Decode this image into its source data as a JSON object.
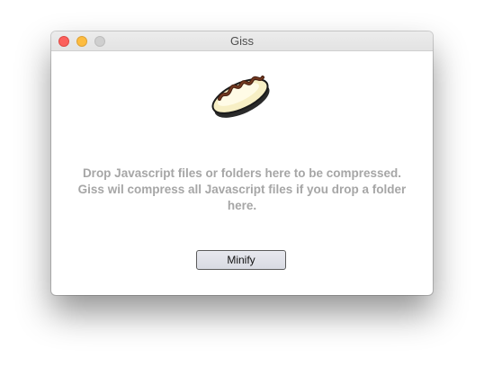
{
  "window": {
    "title": "Giss"
  },
  "titlebar": {
    "buttons": [
      "close",
      "minimize",
      "zoom"
    ]
  },
  "logo": {
    "icon": "eclair-pastry-icon"
  },
  "drop_area": {
    "lines": [
      "Drop Javascript files or folders here to be compressed.",
      "Giss wil compress all Javascript files if you drop a folder",
      "here."
    ]
  },
  "actions": {
    "minify_label": "Minify"
  },
  "colors": {
    "close": "#fc605c",
    "minimize": "#fdbc40",
    "zoom_disabled": "#cfcfcf",
    "message_text": "#a6a6a6"
  }
}
